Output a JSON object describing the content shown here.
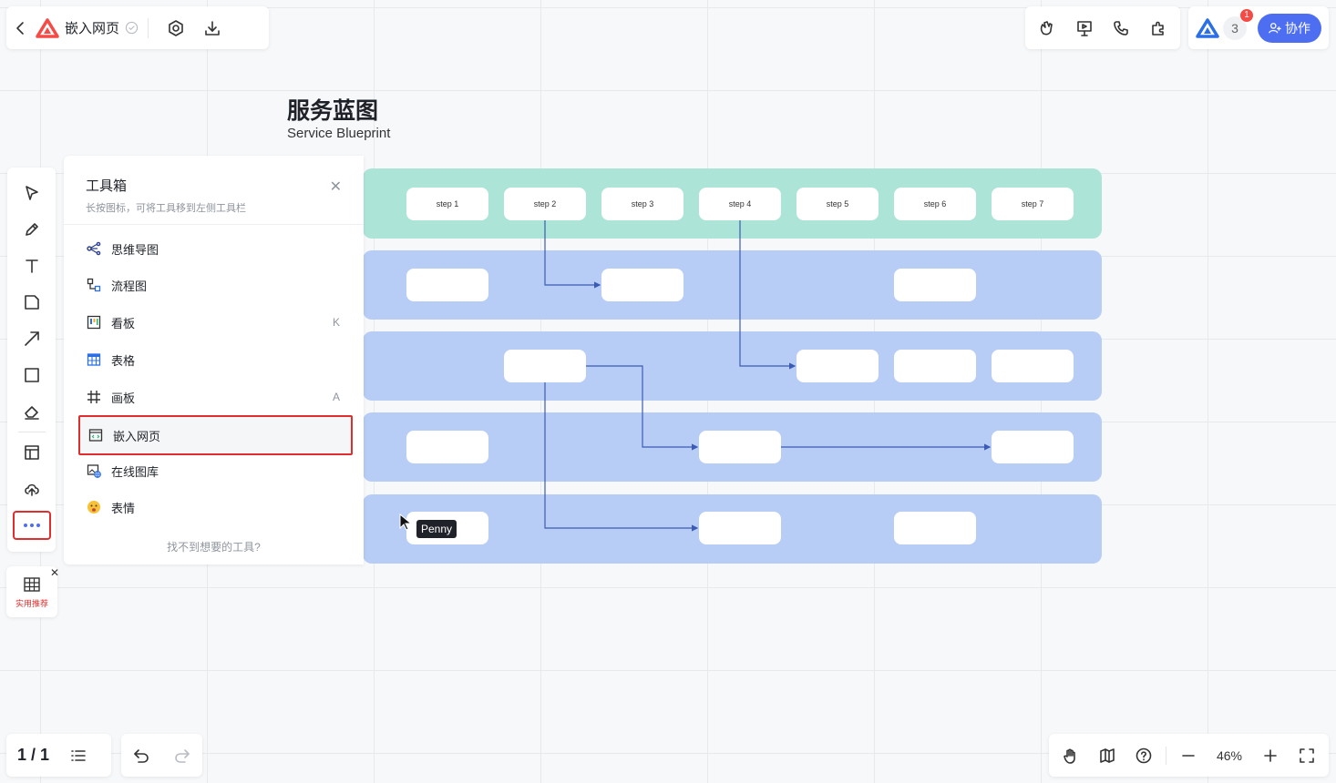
{
  "header": {
    "doc_title": "嵌入网页",
    "brand_color": "#f54a45"
  },
  "collab": {
    "online_count": "3",
    "notification_count": "1",
    "button_label": "协作",
    "accent": "#4e6ef2"
  },
  "board": {
    "title": "服务蓝图",
    "subtitle": "Service Blueprint",
    "steps": [
      "step 1",
      "step 2",
      "step 3",
      "step 4",
      "step 5",
      "step 6",
      "step 7"
    ]
  },
  "toolbox": {
    "title": "工具箱",
    "hint": "长按图标，可将工具移到左侧工具栏",
    "items": [
      {
        "label": "思维导图",
        "key": ""
      },
      {
        "label": "流程图",
        "key": ""
      },
      {
        "label": "看板",
        "key": "K"
      },
      {
        "label": "表格",
        "key": ""
      },
      {
        "label": "画板",
        "key": "A"
      },
      {
        "label": "嵌入网页",
        "key": ""
      },
      {
        "label": "在线图库",
        "key": ""
      },
      {
        "label": "表情",
        "key": ""
      }
    ],
    "footer": "找不到想要的工具?"
  },
  "recommend": {
    "tag": "实用推荐"
  },
  "cursor": {
    "user": "Penny"
  },
  "footer": {
    "page": "1 / 1",
    "zoom": "46%"
  }
}
